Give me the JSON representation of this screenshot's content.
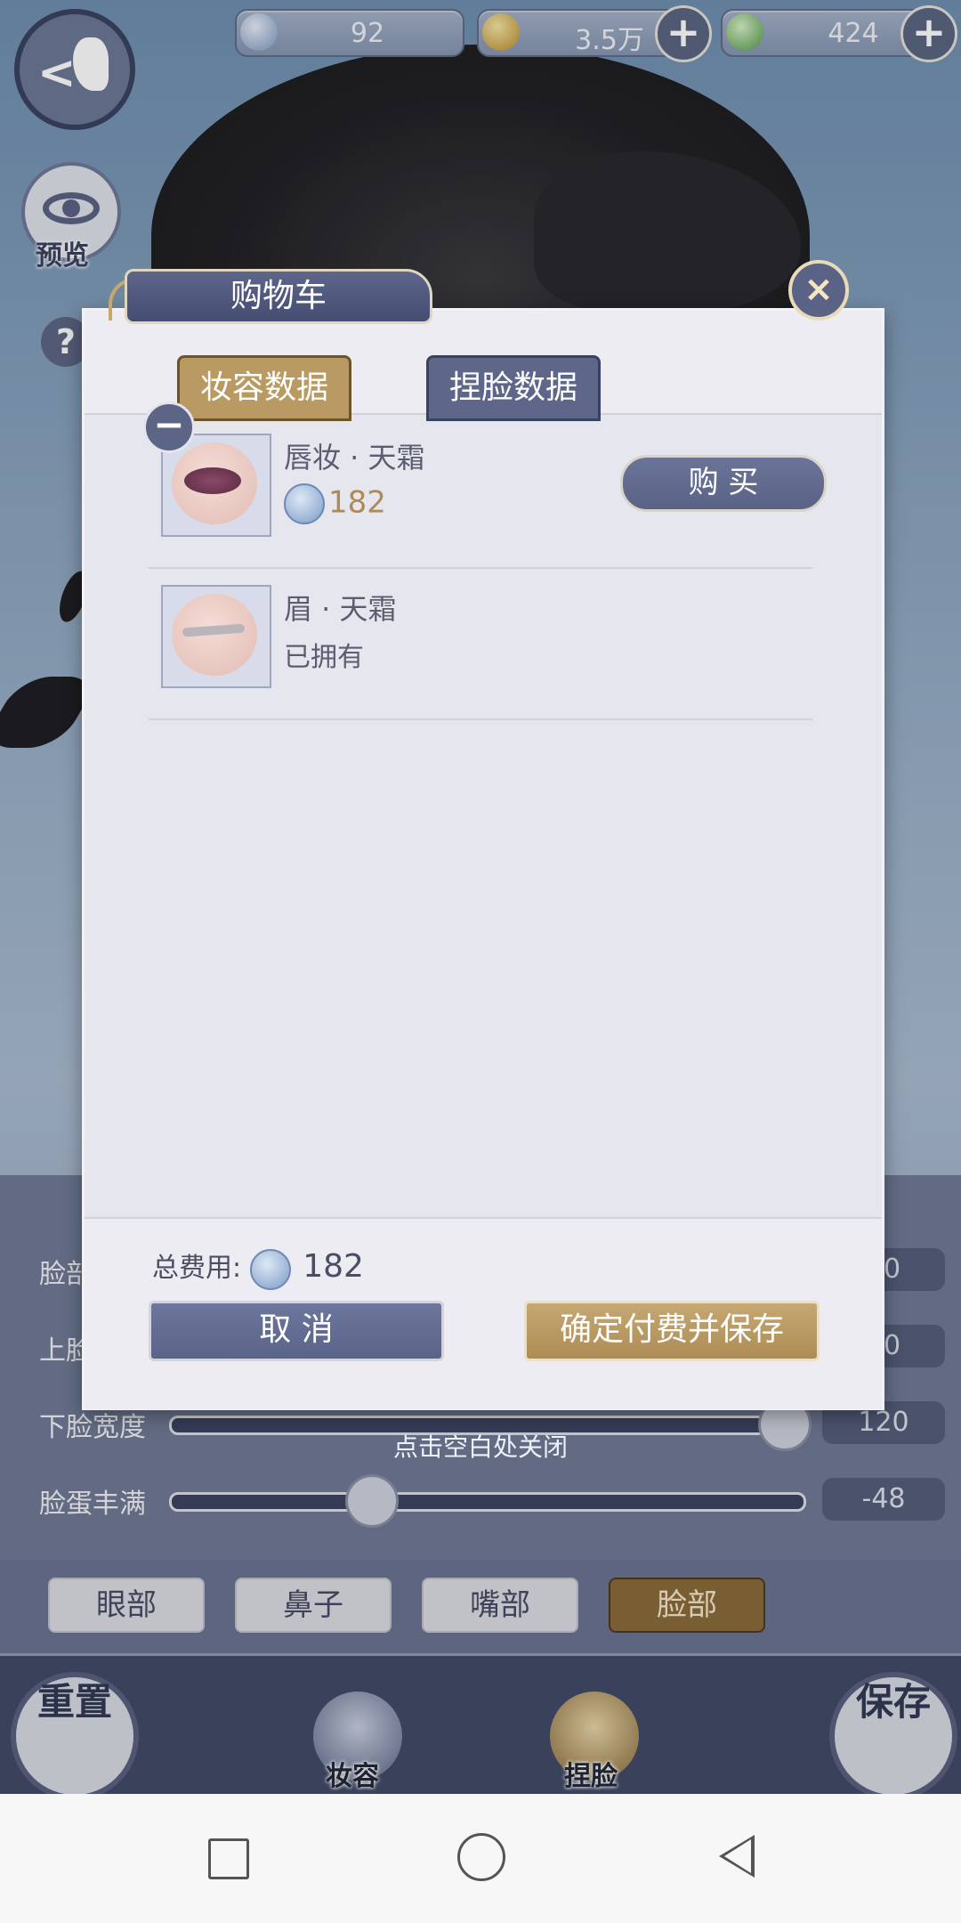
{
  "currency": {
    "jade": "92",
    "coins": "3.5万",
    "energy": "424"
  },
  "left_menu": {
    "preview_label": "预览",
    "help_label": "?"
  },
  "dialog": {
    "title": "购物车",
    "tabs": [
      "妆容数据",
      "捏脸数据"
    ],
    "items": [
      {
        "name": "唇妆 · 天霜",
        "price": "182",
        "action": "购 买"
      },
      {
        "name": "眉 · 天霜",
        "status": "已拥有"
      }
    ],
    "total_label": "总费用:",
    "total_value": "182",
    "cancel_label": "取 消",
    "confirm_label": "确定付费并保存",
    "close_icon": "×"
  },
  "hint": "点击空白处关闭",
  "sliders": [
    {
      "label": "脸部",
      "value": "10"
    },
    {
      "label": "上脸",
      "value": "00"
    },
    {
      "label": "下脸宽度",
      "value": "120"
    },
    {
      "label": "脸蛋丰满",
      "value": "-48"
    }
  ],
  "part_tabs": [
    "眼部",
    "鼻子",
    "嘴部",
    "脸部"
  ],
  "bottom": {
    "reset_label": "重置",
    "makeup_label": "妆容",
    "face_label": "捏脸",
    "save_label": "保存"
  }
}
